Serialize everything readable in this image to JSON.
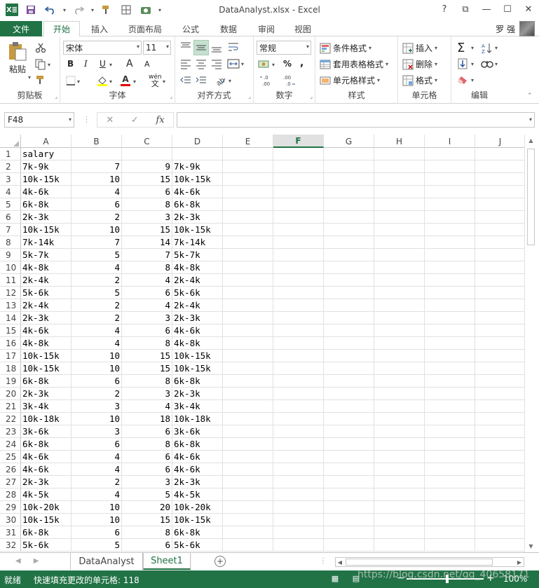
{
  "window": {
    "title": "DataAnalyst.xlsx - Excel",
    "logo": "X≣",
    "help": "?",
    "controls": {
      "ribbon_opts": "⧉",
      "minimize": "—",
      "restore": "☐",
      "close": "✕"
    }
  },
  "qat": {
    "save_icon": "floppy-icon",
    "undo_icon": "undo-icon",
    "redo_icon": "redo-icon"
  },
  "tabs": [
    {
      "label": "文件"
    },
    {
      "label": "开始"
    },
    {
      "label": "插入"
    },
    {
      "label": "页面布局"
    },
    {
      "label": "公式"
    },
    {
      "label": "数据"
    },
    {
      "label": "审阅"
    },
    {
      "label": "视图"
    }
  ],
  "user": {
    "name": "罗 强"
  },
  "ribbon": {
    "clipboard": {
      "label": "剪贴板",
      "paste": "粘贴"
    },
    "font": {
      "label": "字体",
      "name": "宋体",
      "size": "11",
      "bold": "B",
      "italic": "I",
      "underline": "U",
      "grow": "A",
      "shrink": "A",
      "font_color": "A",
      "wen": "wén"
    },
    "alignment": {
      "label": "对齐方式"
    },
    "number": {
      "label": "数字",
      "format": "常规",
      "percent": "%",
      "comma": ",",
      "inc": "←.0\n.00",
      "dec": ".00\n→.0"
    },
    "styles": {
      "label": "样式",
      "conditional": "条件格式",
      "table": "套用表格格式",
      "cell": "单元格样式"
    },
    "cells": {
      "label": "单元格",
      "insert": "插入",
      "delete": "删除",
      "format": "格式"
    },
    "editing": {
      "label": "编辑",
      "sum": "Σ"
    }
  },
  "formula_bar": {
    "name_box": "F48",
    "fx": "fx",
    "cancel": "✕",
    "enter": "✓",
    "value": ""
  },
  "columns": [
    "A",
    "B",
    "C",
    "D",
    "E",
    "F",
    "G",
    "H",
    "I",
    "J"
  ],
  "active_column": "F",
  "rows": [
    {
      "n": "1",
      "a": "salary",
      "b": "",
      "c": "",
      "d": ""
    },
    {
      "n": "2",
      "a": "7k-9k",
      "b": "7",
      "c": "9",
      "d": "7k-9k"
    },
    {
      "n": "3",
      "a": "10k-15k",
      "b": "10",
      "c": "15",
      "d": "10k-15k"
    },
    {
      "n": "4",
      "a": "4k-6k",
      "b": "4",
      "c": "6",
      "d": "4k-6k"
    },
    {
      "n": "5",
      "a": "6k-8k",
      "b": "6",
      "c": "8",
      "d": "6k-8k"
    },
    {
      "n": "6",
      "a": "2k-3k",
      "b": "2",
      "c": "3",
      "d": "2k-3k"
    },
    {
      "n": "7",
      "a": "10k-15k",
      "b": "10",
      "c": "15",
      "d": "10k-15k"
    },
    {
      "n": "8",
      "a": "7k-14k",
      "b": "7",
      "c": "14",
      "d": "7k-14k"
    },
    {
      "n": "9",
      "a": "5k-7k",
      "b": "5",
      "c": "7",
      "d": "5k-7k"
    },
    {
      "n": "10",
      "a": "4k-8k",
      "b": "4",
      "c": "8",
      "d": "4k-8k"
    },
    {
      "n": "11",
      "a": "2k-4k",
      "b": "2",
      "c": "4",
      "d": "2k-4k"
    },
    {
      "n": "12",
      "a": "5k-6k",
      "b": "5",
      "c": "6",
      "d": "5k-6k"
    },
    {
      "n": "13",
      "a": "2k-4k",
      "b": "2",
      "c": "4",
      "d": "2k-4k"
    },
    {
      "n": "14",
      "a": "2k-3k",
      "b": "2",
      "c": "3",
      "d": "2k-3k"
    },
    {
      "n": "15",
      "a": "4k-6k",
      "b": "4",
      "c": "6",
      "d": "4k-6k"
    },
    {
      "n": "16",
      "a": "4k-8k",
      "b": "4",
      "c": "8",
      "d": "4k-8k"
    },
    {
      "n": "17",
      "a": "10k-15k",
      "b": "10",
      "c": "15",
      "d": "10k-15k"
    },
    {
      "n": "18",
      "a": "10k-15k",
      "b": "10",
      "c": "15",
      "d": "10k-15k"
    },
    {
      "n": "19",
      "a": "6k-8k",
      "b": "6",
      "c": "8",
      "d": "6k-8k"
    },
    {
      "n": "20",
      "a": "2k-3k",
      "b": "2",
      "c": "3",
      "d": "2k-3k"
    },
    {
      "n": "21",
      "a": "3k-4k",
      "b": "3",
      "c": "4",
      "d": "3k-4k"
    },
    {
      "n": "22",
      "a": "10k-18k",
      "b": "10",
      "c": "18",
      "d": "10k-18k"
    },
    {
      "n": "23",
      "a": "3k-6k",
      "b": "3",
      "c": "6",
      "d": "3k-6k"
    },
    {
      "n": "24",
      "a": "6k-8k",
      "b": "6",
      "c": "8",
      "d": "6k-8k"
    },
    {
      "n": "25",
      "a": "4k-6k",
      "b": "4",
      "c": "6",
      "d": "4k-6k"
    },
    {
      "n": "26",
      "a": "4k-6k",
      "b": "4",
      "c": "6",
      "d": "4k-6k"
    },
    {
      "n": "27",
      "a": "2k-3k",
      "b": "2",
      "c": "3",
      "d": "2k-3k"
    },
    {
      "n": "28",
      "a": "4k-5k",
      "b": "4",
      "c": "5",
      "d": "4k-5k"
    },
    {
      "n": "29",
      "a": "10k-20k",
      "b": "10",
      "c": "20",
      "d": "10k-20k"
    },
    {
      "n": "30",
      "a": "10k-15k",
      "b": "10",
      "c": "15",
      "d": "10k-15k"
    },
    {
      "n": "31",
      "a": "6k-8k",
      "b": "6",
      "c": "8",
      "d": "6k-8k"
    },
    {
      "n": "32",
      "a": "5k-6k",
      "b": "5",
      "c": "6",
      "d": "5k-6k"
    }
  ],
  "sheets": [
    {
      "label": "DataAnalyst"
    },
    {
      "label": "Sheet1"
    }
  ],
  "active_sheet": "Sheet1",
  "status": {
    "mode": "就绪",
    "message": "快速填充更改的单元格: 118",
    "zoom": "100%",
    "watermark": "https://blog.csdn.net/qq_40658171"
  },
  "colors": {
    "excel_green": "#217346",
    "selection": "#c6e0cf"
  }
}
